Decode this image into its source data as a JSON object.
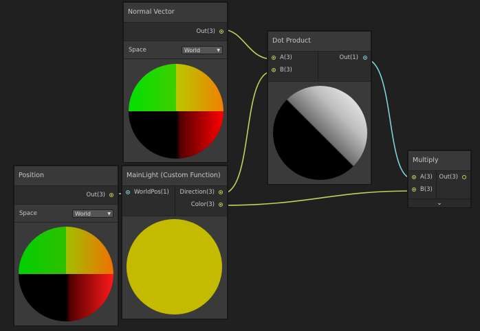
{
  "nodes": {
    "normal_vector": {
      "title": "Normal Vector",
      "out_label": "Out(3)",
      "space_label": "Space",
      "space_value": "World"
    },
    "dot_product": {
      "title": "Dot Product",
      "input_a": "A(3)",
      "input_b": "B(3)",
      "out_label": "Out(1)"
    },
    "position": {
      "title": "Position",
      "out_label": "Out(3)",
      "space_label": "Space",
      "space_value": "World"
    },
    "main_light": {
      "title": "MainLight (Custom Function)",
      "input_worldpos": "WorldPos(1)",
      "out_direction": "Direction(3)",
      "out_color": "Color(3)"
    },
    "multiply": {
      "title": "Multiply",
      "input_a": "A(3)",
      "input_b": "B(3)",
      "out_label": "Out(3)"
    }
  },
  "colors": {
    "background": "#202020",
    "wire_vector3": "#c8cf5a",
    "wire_vector1": "#7fd3df",
    "light_preview": "#c4bb00"
  },
  "icons": {
    "collapse": "chevron-down-icon",
    "dropdown": "triangle-down-icon"
  }
}
